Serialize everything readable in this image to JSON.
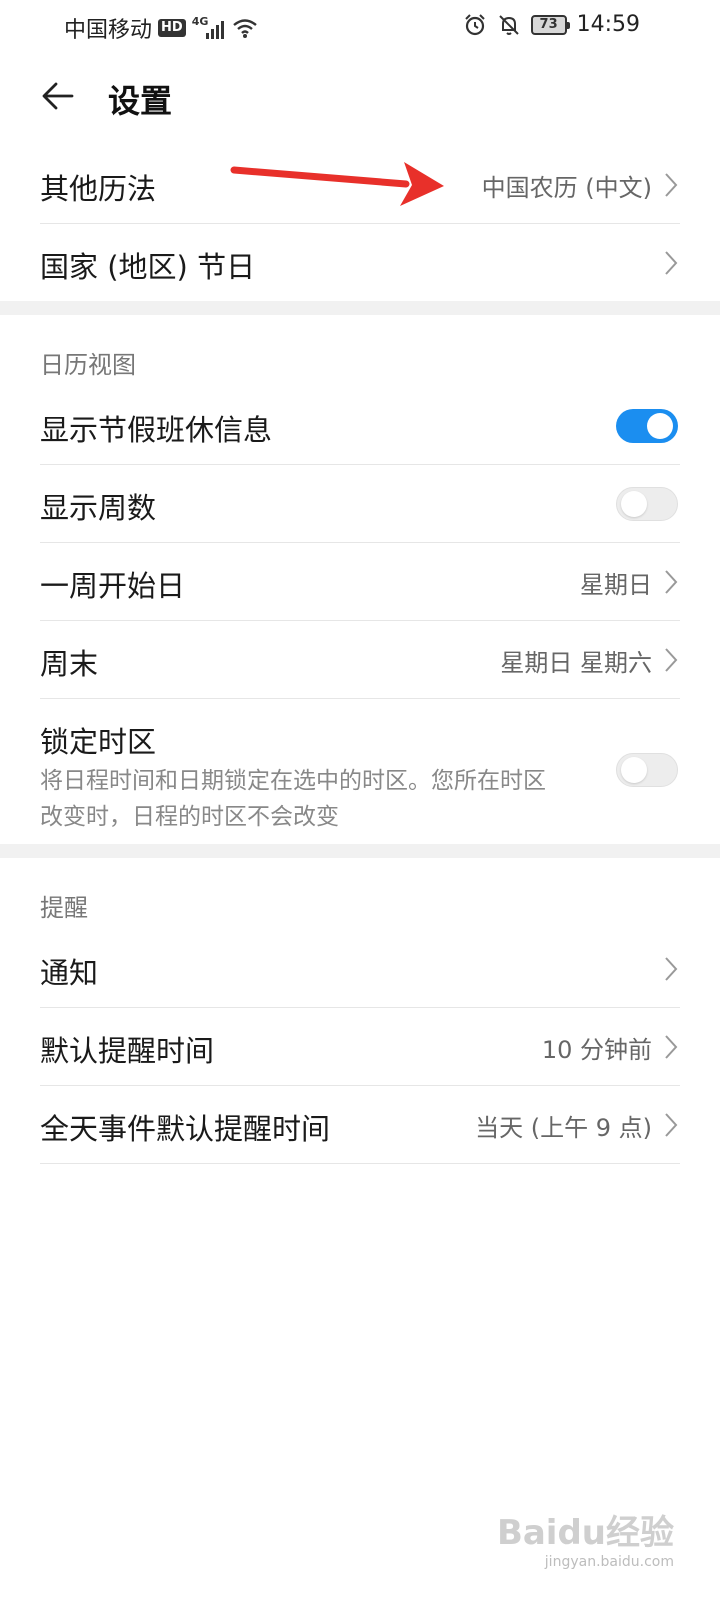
{
  "status_bar": {
    "carrier": "中国移动",
    "hd": "HD",
    "network": "4G",
    "battery": "73",
    "time": "14:59"
  },
  "header": {
    "title": "设置"
  },
  "section1": {
    "rows": [
      {
        "label": "其他历法",
        "value": "中国农历 (中文)"
      },
      {
        "label": "国家 (地区) 节日",
        "value": ""
      }
    ]
  },
  "calendar_view": {
    "title": "日历视图",
    "holiday_info": {
      "label": "显示节假班休信息",
      "on": true
    },
    "week_number": {
      "label": "显示周数",
      "on": false
    },
    "week_start": {
      "label": "一周开始日",
      "value": "星期日"
    },
    "weekend": {
      "label": "周末",
      "value": "星期日 星期六"
    },
    "lock_timezone": {
      "label": "锁定时区",
      "description": "将日程时间和日期锁定在选中的时区。您所在时区改变时，日程的时区不会改变",
      "on": false
    }
  },
  "reminder": {
    "title": "提醒",
    "notify": {
      "label": "通知"
    },
    "default_time": {
      "label": "默认提醒时间",
      "value": "10 分钟前"
    },
    "allday_time": {
      "label": "全天事件默认提醒时间",
      "value": "当天 (上午 9 点)"
    }
  },
  "watermark": {
    "logo": "Baidu经验",
    "url": "jingyan.baidu.com"
  },
  "colors": {
    "accent": "#1b8ef0",
    "annotation": "#e8302a"
  }
}
